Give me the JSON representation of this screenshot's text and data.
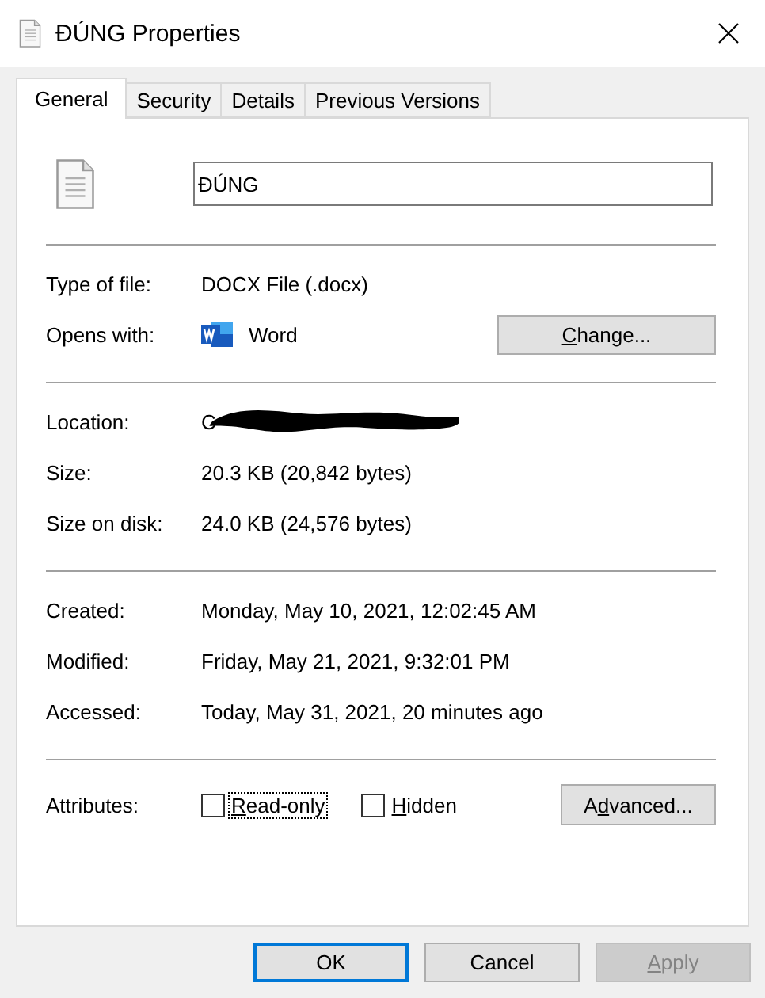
{
  "window": {
    "title": "ĐÚNG Properties"
  },
  "tabs": [
    {
      "label": "General",
      "selected": true
    },
    {
      "label": "Security",
      "selected": false
    },
    {
      "label": "Details",
      "selected": false
    },
    {
      "label": "Previous Versions",
      "selected": false
    }
  ],
  "file_name": {
    "value": "ĐÚNG"
  },
  "groups": [
    {
      "rows": [
        {
          "label": "Type of file:",
          "value": "DOCX File (.docx)"
        },
        {
          "label": "Opens with:",
          "value": "Word",
          "kind": "app",
          "button": {
            "access_key": "C",
            "after": "hange..."
          }
        }
      ]
    },
    {
      "rows": [
        {
          "label": "Location:",
          "value": "C",
          "kind": "redacted"
        },
        {
          "label": "Size:",
          "value": "20.3 KB (20,842 bytes)"
        },
        {
          "label": "Size on disk:",
          "value": "24.0 KB (24,576 bytes)"
        }
      ]
    },
    {
      "rows": [
        {
          "label": "Created:",
          "value": "Monday, May 10, 2021, 12:02:45 AM"
        },
        {
          "label": "Modified:",
          "value": "Friday, May 21, 2021, 9:32:01 PM"
        },
        {
          "label": "Accessed:",
          "value": "Today, May 31, 2021, 20 minutes ago"
        }
      ]
    }
  ],
  "attributes": {
    "label": "Attributes:",
    "checkboxes": [
      {
        "access_key": "R",
        "after": "ead-only",
        "checked": false,
        "focused": true
      },
      {
        "access_key": "H",
        "after": "idden",
        "checked": false,
        "focused": false
      }
    ],
    "button": {
      "before": "A",
      "access_key": "d",
      "after": "vanced..."
    }
  },
  "buttons": [
    {
      "before": "OK",
      "default": true,
      "disabled": false
    },
    {
      "before": "Cancel",
      "default": false,
      "disabled": false
    },
    {
      "access_key": "A",
      "after": "pply",
      "default": false,
      "disabled": true
    }
  ]
}
